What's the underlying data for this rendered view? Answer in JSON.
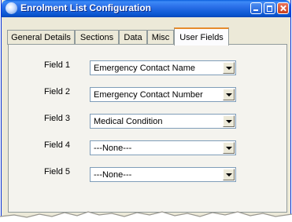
{
  "window": {
    "title": "Enrolment List Configuration"
  },
  "tabs": [
    {
      "label": "General Details",
      "active": false
    },
    {
      "label": "Sections",
      "active": false
    },
    {
      "label": "Data",
      "active": false
    },
    {
      "label": "Misc",
      "active": false
    },
    {
      "label": "User Fields",
      "active": true
    }
  ],
  "fields": [
    {
      "label": "Field 1",
      "value": "Emergency Contact Name"
    },
    {
      "label": "Field 2",
      "value": "Emergency Contact Number"
    },
    {
      "label": "Field 3",
      "value": "Medical Condition"
    },
    {
      "label": "Field 4",
      "value": "---None---"
    },
    {
      "label": "Field 5",
      "value": "---None---"
    }
  ],
  "colors": {
    "titlebar": "#0a56d0",
    "tab_highlight": "#e68b2c",
    "dialog_bg": "#ece9d8"
  }
}
